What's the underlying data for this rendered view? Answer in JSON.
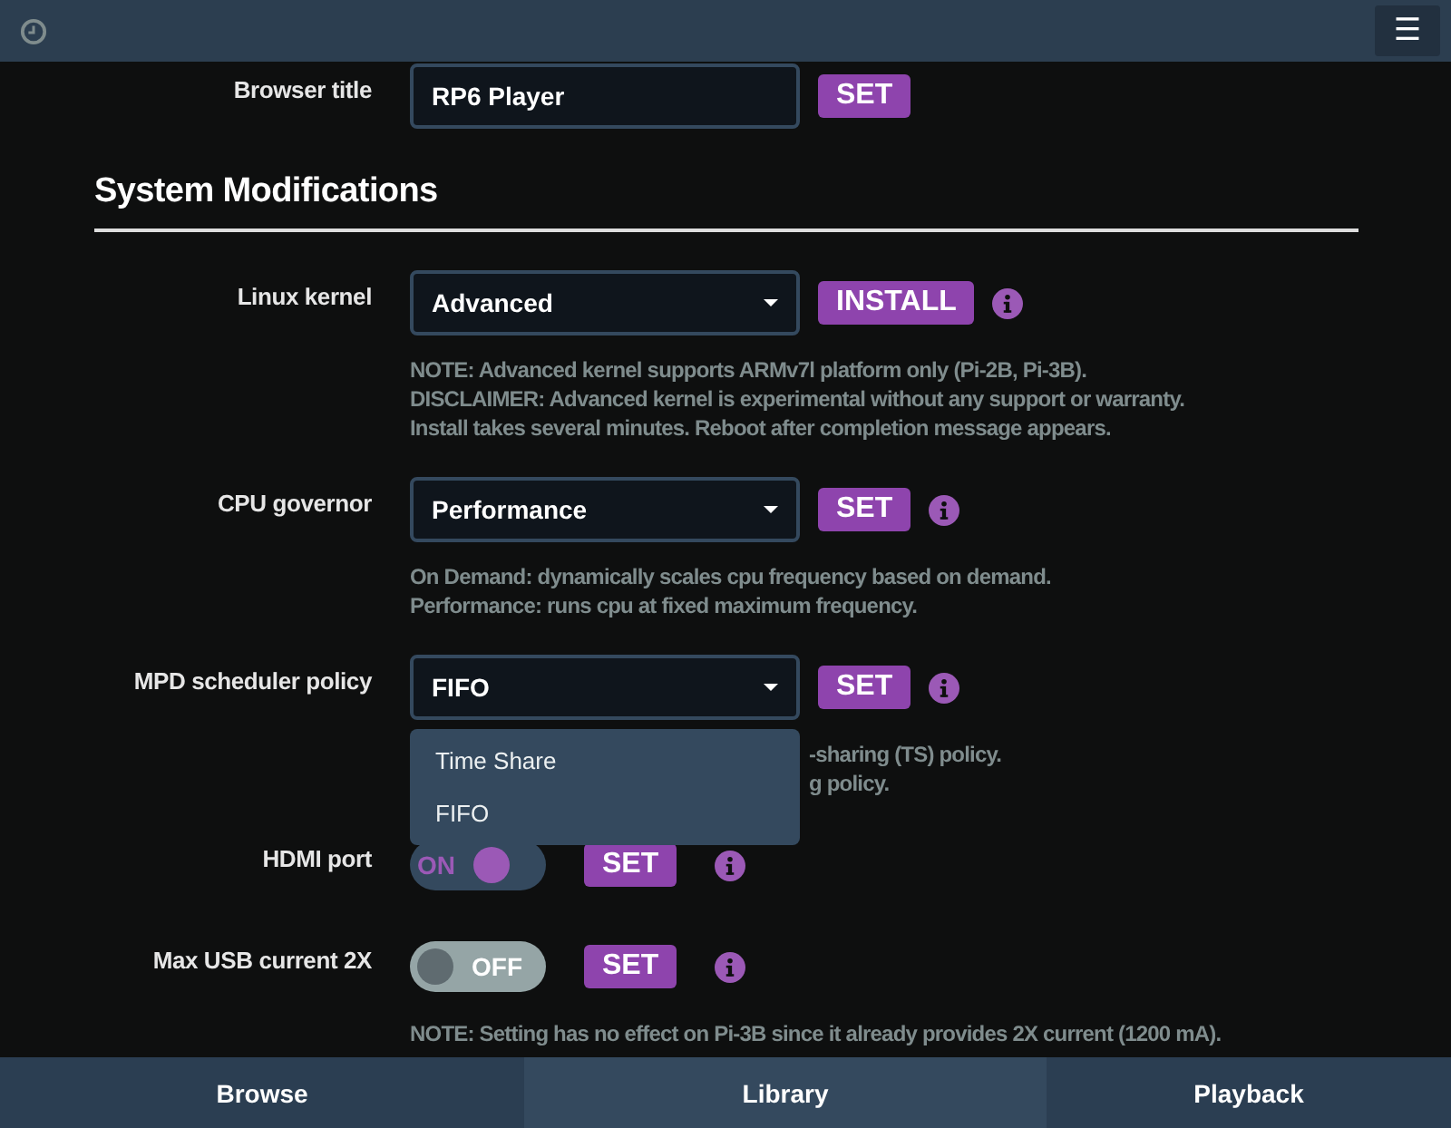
{
  "header": {
    "menu_icon": "☰"
  },
  "top_row": {
    "label": "Browser title",
    "kind": "text",
    "value": "RP6 Player",
    "button": "SET"
  },
  "section": {
    "title": "System Modifications"
  },
  "rows": [
    {
      "label": "Linux kernel",
      "kind": "select",
      "value": "Advanced",
      "button": "INSTALL",
      "info": true,
      "notes": [
        "NOTE: Advanced kernel supports ARMv7l platform only (Pi-2B, Pi-3B).",
        "DISCLAIMER: Advanced kernel is experimental without any support or warranty.",
        "Install takes several minutes. Reboot after completion message appears."
      ]
    },
    {
      "label": "CPU governor",
      "kind": "select",
      "value": "Performance",
      "button": "SET",
      "info": true,
      "notes": [
        "On Demand: dynamically scales cpu frequency based on demand.",
        "Performance: runs cpu at fixed maximum frequency."
      ]
    },
    {
      "label": "MPD scheduler policy",
      "kind": "select",
      "value": "FIFO",
      "button": "SET",
      "info": true,
      "expanded": true,
      "options": [
        "Time Share",
        "FIFO"
      ],
      "notes": [
        "-sharing (TS) policy.",
        "g policy."
      ]
    },
    {
      "label": "HDMI port",
      "kind": "toggle",
      "on": true,
      "toggle_text": "ON",
      "button": "SET",
      "info": true
    },
    {
      "label": "Max USB current 2X",
      "kind": "toggle",
      "on": false,
      "toggle_text": "OFF",
      "button": "SET",
      "info": true,
      "notes": [
        "NOTE: Setting has no effect on Pi-3B since it already provides 2X current (1200 mA)."
      ]
    }
  ],
  "footer_tabs": [
    {
      "label": "Browse",
      "selected": false
    },
    {
      "label": "Library",
      "selected": true
    },
    {
      "label": "Playback",
      "selected": false
    }
  ]
}
